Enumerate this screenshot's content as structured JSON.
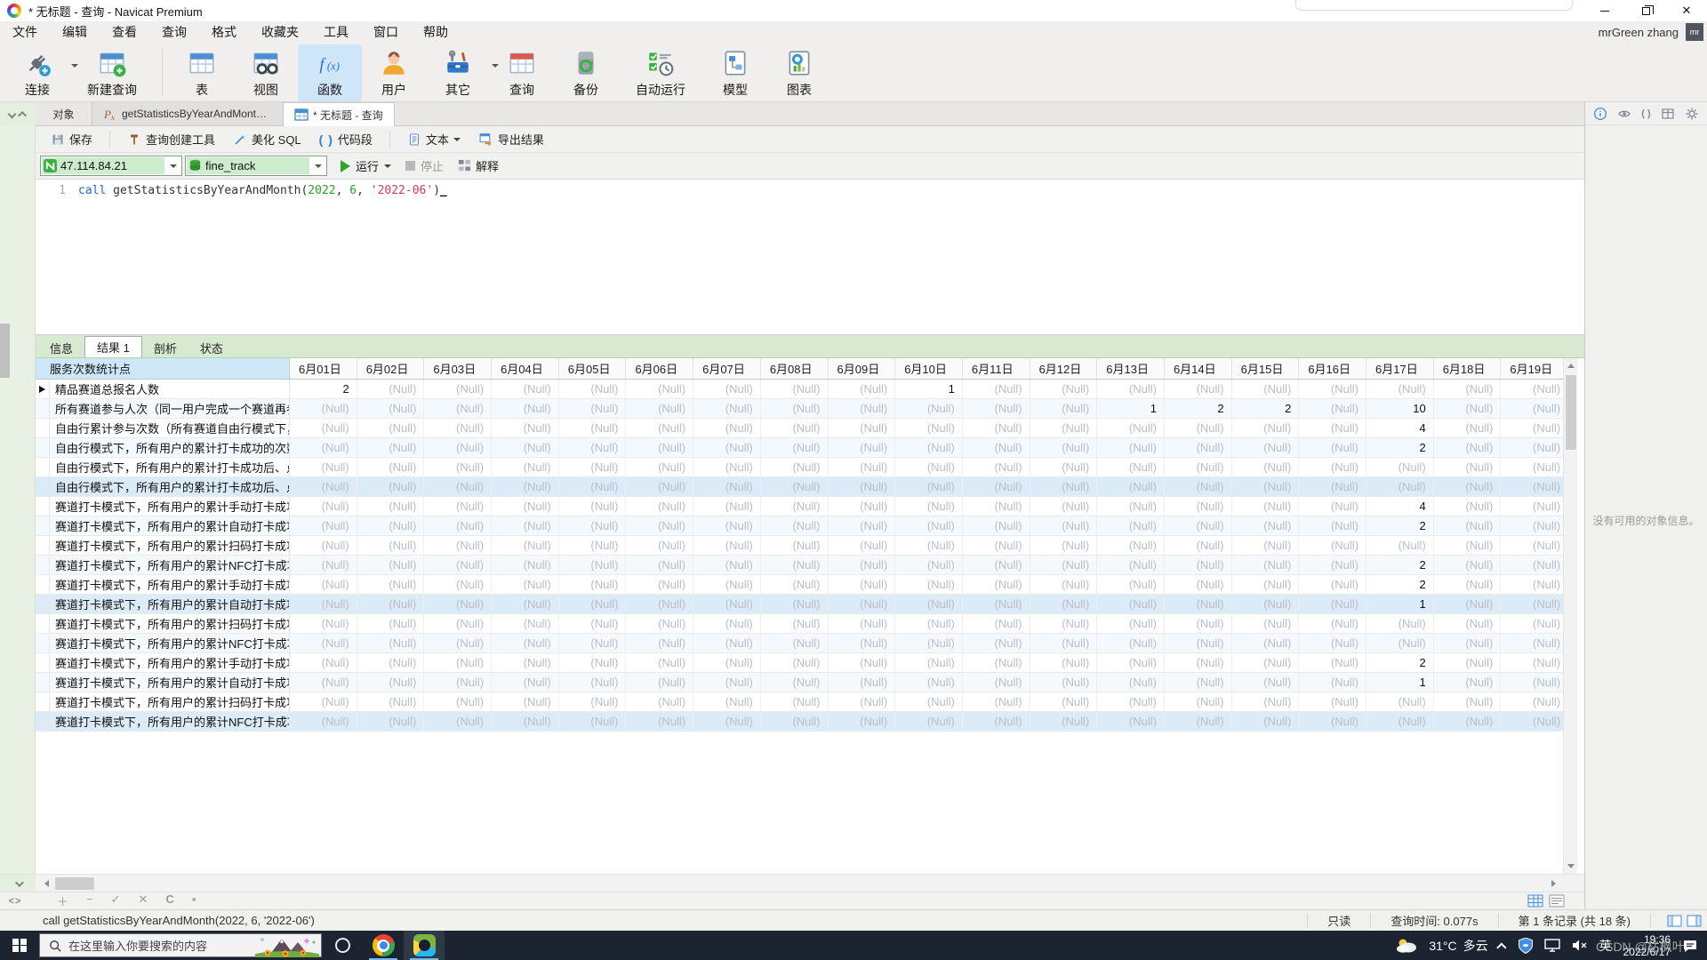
{
  "window": {
    "title": "* 无标题 - 查询 - Navicat Premium"
  },
  "account": {
    "name": "mrGreen zhang",
    "avatar": "mr"
  },
  "menu": {
    "items": [
      "文件",
      "编辑",
      "查看",
      "查询",
      "格式",
      "收藏夹",
      "工具",
      "窗口",
      "帮助"
    ]
  },
  "toolbar": {
    "items": [
      {
        "label": "连接",
        "icon": "connection-icon",
        "dropdown": true
      },
      {
        "label": "新建查询",
        "icon": "new-query-icon",
        "wide": true
      },
      {
        "label": "表",
        "icon": "table-icon",
        "sep_before": true
      },
      {
        "label": "视图",
        "icon": "view-icon"
      },
      {
        "label": "函数",
        "icon": "function-icon",
        "active": true
      },
      {
        "label": "用户",
        "icon": "user-icon"
      },
      {
        "label": "其它",
        "icon": "others-icon",
        "dropdown": true
      },
      {
        "label": "查询",
        "icon": "query-icon"
      },
      {
        "label": "备份",
        "icon": "backup-icon"
      },
      {
        "label": "自动运行",
        "icon": "automation-icon",
        "wide": true
      },
      {
        "label": "模型",
        "icon": "model-icon"
      },
      {
        "label": "图表",
        "icon": "chart-icon"
      }
    ]
  },
  "doc_tabs": {
    "items": [
      {
        "label": "对象",
        "icon": null,
        "first": true
      },
      {
        "label": "getStatisticsByYearAndMonth @fine_...",
        "icon": "procedure-icon"
      },
      {
        "label": "* 无标题 - 查询",
        "icon": "query-doc-icon",
        "active": true
      }
    ]
  },
  "query_toolbar": {
    "save": "保存",
    "builder": "查询创建工具",
    "beautify": "美化 SQL",
    "snippet": "代码段",
    "text_view": "文本",
    "export": "导出结果"
  },
  "connection_bar": {
    "server": "47.114.84.21",
    "database": "fine_track",
    "run": "运行",
    "stop": "停止",
    "explain": "解释"
  },
  "editor": {
    "line_number": "1",
    "sql_tokens": [
      {
        "t": "call ",
        "c": "kw"
      },
      {
        "t": "getStatisticsByYearAndMonth(",
        "c": "pl"
      },
      {
        "t": "2022",
        "c": "num"
      },
      {
        "t": ", ",
        "c": "pl"
      },
      {
        "t": "6",
        "c": "num"
      },
      {
        "t": ", ",
        "c": "pl"
      },
      {
        "t": "'2022-06'",
        "c": "str"
      },
      {
        "t": ")",
        "c": "pl"
      }
    ]
  },
  "result_tabs": {
    "items": [
      "信息",
      "结果 1",
      "剖析",
      "状态"
    ],
    "active_index": 1
  },
  "grid": {
    "corner_header": "服务次数统计点",
    "null_display": "(Null)",
    "date_headers": [
      "6月01日",
      "6月02日",
      "6月03日",
      "6月04日",
      "6月05日",
      "6月06日",
      "6月07日",
      "6月08日",
      "6月09日",
      "6月10日",
      "6月11日",
      "6月12日",
      "6月13日",
      "6月14日",
      "6月15日",
      "6月16日",
      "6月17日",
      "6月18日",
      "6月19日"
    ],
    "rows": [
      {
        "label": "精品赛道总报名人数",
        "values": {
          "0": 2,
          "9": 1
        }
      },
      {
        "label": "所有赛道参与人次（同一用户完成一个赛道再参与一",
        "values": {
          "12": 1,
          "13": 2,
          "14": 2,
          "16": 10
        }
      },
      {
        "label": "自由行累计参与次数（所有赛道自由行模式下，用户",
        "values": {
          "16": 4
        }
      },
      {
        "label": "自由行模式下，所有用户的累计打卡成功的次数",
        "values": {
          "16": 2
        }
      },
      {
        "label": "自由行模式下，所有用户的累计打卡成功后、点击开",
        "values": {}
      },
      {
        "label": "自由行模式下，所有用户的累计打卡成功后、点击开",
        "values": {}
      },
      {
        "label": "赛道打卡模式下，所有用户的累计手动打卡成功的次",
        "values": {
          "16": 4
        }
      },
      {
        "label": "赛道打卡模式下，所有用户的累计自动打卡成功的次",
        "values": {
          "16": 2
        }
      },
      {
        "label": "赛道打卡模式下，所有用户的累计扫码打卡成功的次",
        "values": {}
      },
      {
        "label": "赛道打卡模式下，所有用户的累计NFC打卡成功的次",
        "values": {
          "16": 2
        }
      },
      {
        "label": "赛道打卡模式下，所有用户的累计手动打卡成功后、",
        "values": {
          "16": 2
        }
      },
      {
        "label": "赛道打卡模式下，所有用户的累计自动打卡成功后、",
        "values": {
          "16": 1
        }
      },
      {
        "label": "赛道打卡模式下，所有用户的累计扫码打卡成功后、",
        "values": {}
      },
      {
        "label": "赛道打卡模式下，所有用户的累计NFC打卡成功后、",
        "values": {}
      },
      {
        "label": "赛道打卡模式下，所有用户的累计手动打卡成功后、",
        "values": {
          "16": 2
        }
      },
      {
        "label": "赛道打卡模式下，所有用户的累计自动打卡成功后、",
        "values": {
          "16": 1
        }
      },
      {
        "label": "赛道打卡模式下，所有用户的累计扫码打卡成功后、",
        "values": {}
      },
      {
        "label": "赛道打卡模式下，所有用户的累计NFC打卡成功后、",
        "values": {}
      }
    ]
  },
  "right_panel": {
    "message": "没有可用的对象信息。"
  },
  "status_bar": {
    "query_text": "call getStatisticsByYearAndMonth(2022, 6, '2022-06')",
    "readonly": "只读",
    "query_time": "查询时间: 0.077s",
    "record_info": "第 1 条记录 (共 18 条)"
  },
  "taskbar": {
    "search_placeholder": "在这里输入你要搜索的内容",
    "temperature": "31°C",
    "weather": "多云",
    "language": "英",
    "time": "19:36",
    "date": "2022/6/17"
  },
  "watermark": "CSDN @枯枫叶"
}
